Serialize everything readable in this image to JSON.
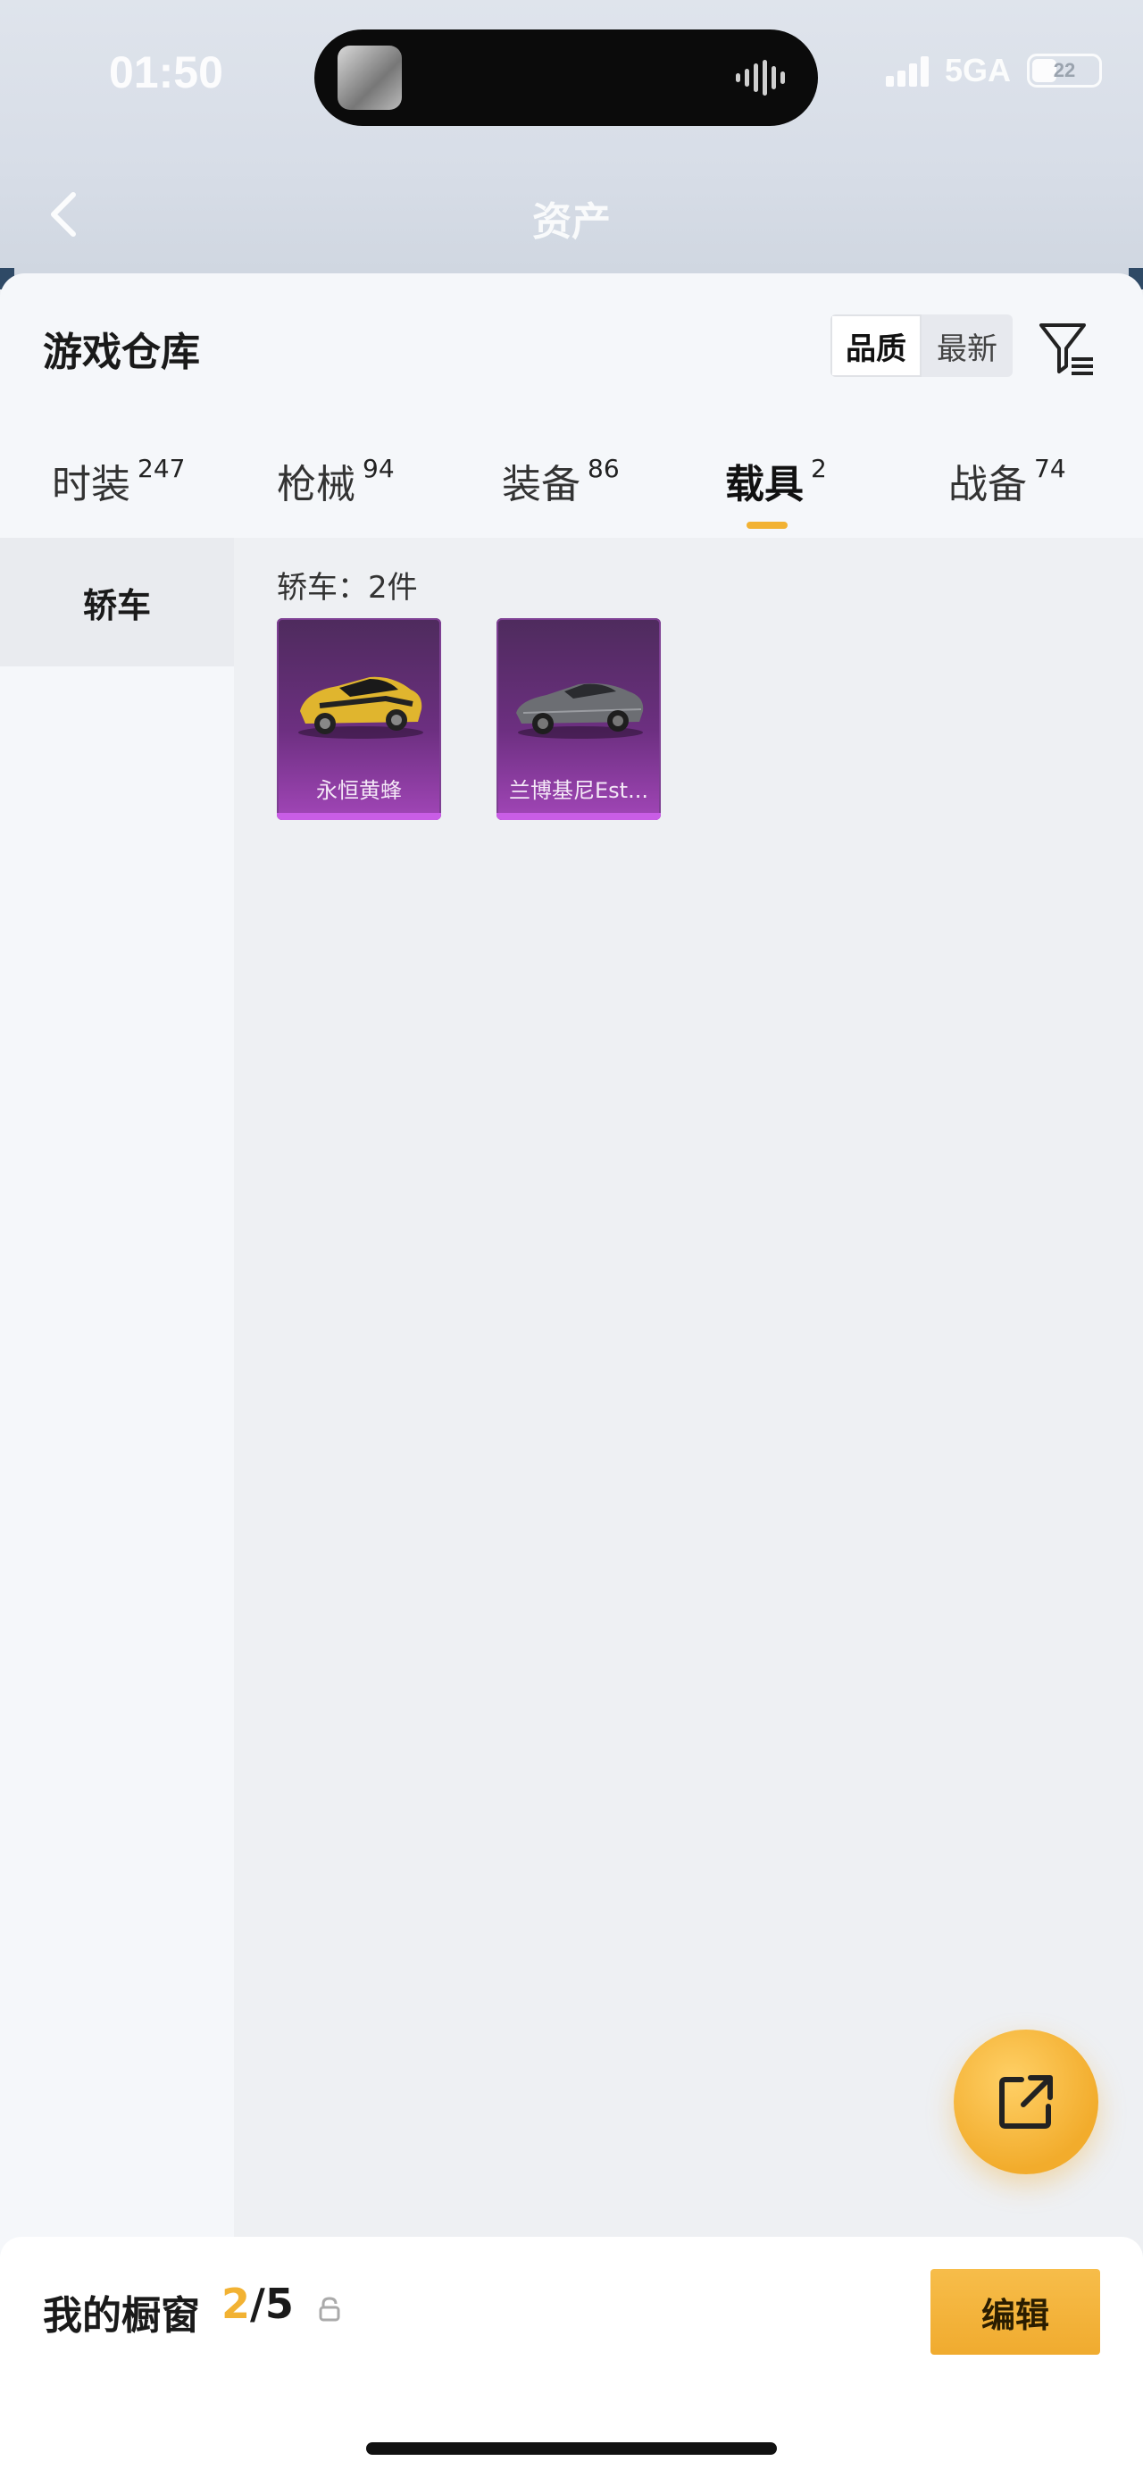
{
  "status_bar": {
    "time": "01:50",
    "network": "5GA",
    "battery": "22"
  },
  "nav": {
    "title": "资产"
  },
  "warehouse": {
    "title": "游戏仓库",
    "sort": {
      "options": [
        "品质",
        "最新"
      ],
      "selected": "品质"
    }
  },
  "tabs": [
    {
      "label": "时装",
      "count": "247"
    },
    {
      "label": "枪械",
      "count": "94"
    },
    {
      "label": "装备",
      "count": "86"
    },
    {
      "label": "载具",
      "count": "2",
      "active": true
    },
    {
      "label": "战备",
      "count": "74"
    }
  ],
  "sidebar": {
    "items": [
      {
        "label": "轿车",
        "active": true
      }
    ]
  },
  "group": {
    "label": "轿车：2件"
  },
  "items": [
    {
      "name": "永恒黄蜂",
      "car_color": "#e0b52e"
    },
    {
      "name": "兰博基尼Est...",
      "car_color": "#6c6e73"
    }
  ],
  "showcase": {
    "title": "我的橱窗",
    "count_used": "2",
    "count_total": "/5",
    "edit_label": "编辑"
  },
  "colors": {
    "accent": "#f2b233",
    "card_purple": "#6c2f80"
  }
}
